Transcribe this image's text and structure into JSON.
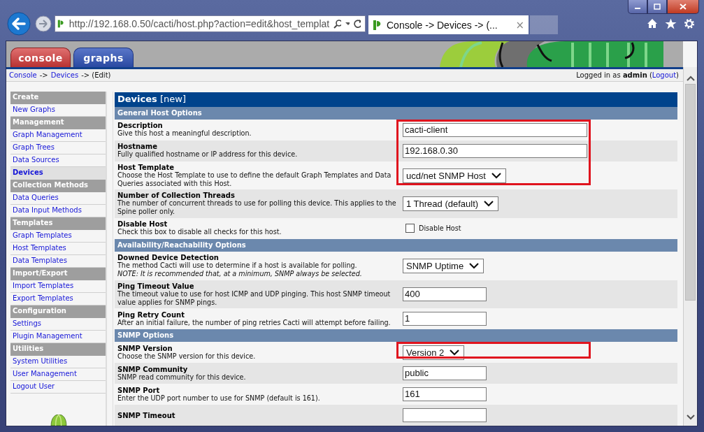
{
  "browser": {
    "url": "http://192.168.0.50/cacti/host.php?action=edit&host_templat",
    "tab_title": "Console -> Devices -> (...",
    "tab_close": "×"
  },
  "app_tabs": [
    {
      "label": "console",
      "selected": true
    },
    {
      "label": "graphs",
      "selected": false
    }
  ],
  "breadcrumb": [
    {
      "kind": "link",
      "text": "Console"
    },
    {
      "kind": "text",
      "text": "->"
    },
    {
      "kind": "link",
      "text": "Devices"
    },
    {
      "kind": "text",
      "text": "-> (Edit)"
    }
  ],
  "login": [
    {
      "kind": "text",
      "text": "Logged in as **admin** ("
    },
    {
      "kind": "link",
      "text": "Logout"
    },
    {
      "kind": "text",
      "text": ")"
    }
  ],
  "sidebar": [
    {
      "kind": "header",
      "label": "Create"
    },
    {
      "kind": "link",
      "label": "New Graphs",
      "selected": false
    },
    {
      "kind": "header",
      "label": "Management"
    },
    {
      "kind": "link",
      "label": "Graph Management",
      "selected": false
    },
    {
      "kind": "link",
      "label": "Graph Trees",
      "selected": false
    },
    {
      "kind": "link",
      "label": "Data Sources",
      "selected": false
    },
    {
      "kind": "link",
      "label": "Devices",
      "selected": true
    },
    {
      "kind": "header",
      "label": "Collection Methods"
    },
    {
      "kind": "link",
      "label": "Data Queries",
      "selected": false
    },
    {
      "kind": "link",
      "label": "Data Input Methods",
      "selected": false
    },
    {
      "kind": "header",
      "label": "Templates"
    },
    {
      "kind": "link",
      "label": "Graph Templates",
      "selected": false
    },
    {
      "kind": "link",
      "label": "Host Templates",
      "selected": false
    },
    {
      "kind": "link",
      "label": "Data Templates",
      "selected": false
    },
    {
      "kind": "header",
      "label": "Import/Export"
    },
    {
      "kind": "link",
      "label": "Import Templates",
      "selected": false
    },
    {
      "kind": "link",
      "label": "Export Templates",
      "selected": false
    },
    {
      "kind": "header",
      "label": "Configuration"
    },
    {
      "kind": "link",
      "label": "Settings",
      "selected": false
    },
    {
      "kind": "link",
      "label": "Plugin Management",
      "selected": false
    },
    {
      "kind": "header",
      "label": "Utilities"
    },
    {
      "kind": "link",
      "label": "System Utilities",
      "selected": false
    },
    {
      "kind": "link",
      "label": "User Management",
      "selected": false
    },
    {
      "kind": "link",
      "label": "Logout User",
      "selected": false
    }
  ],
  "form": {
    "title": "**Devices** [new]",
    "sections": [
      {
        "title": "General Host Options",
        "rows": [
          {
            "label": "Description",
            "description": "Give this host a meaningful description.",
            "kind": "text",
            "value": "cacti-client",
            "wide": true,
            "highlighted": true
          },
          {
            "label": "Hostname",
            "description": "Fully qualified hostname or IP address for this device.",
            "kind": "text",
            "value": "192.168.0.30",
            "wide": true,
            "highlighted": true
          },
          {
            "label": "Host Template",
            "description": "Choose the Host Template to use to define the default Graph Templates and Data Queries associated with this Host.",
            "kind": "select",
            "value": "ucd/net SNMP Host",
            "highlighted": true
          },
          {
            "label": "Number of Collection Threads",
            "description": "The number of concurrent threads to use for polling this device. This applies to the Spine poller only.",
            "kind": "select",
            "value": "1 Thread (default)",
            "highlighted": false
          },
          {
            "label": "Disable Host",
            "description": "Check this box to disable all checks for this host.",
            "kind": "checkbox",
            "checked": false,
            "value": "Disable Host",
            "highlighted": false
          }
        ]
      },
      {
        "title": "Availability/Reachability Options",
        "rows": [
          {
            "label": "Downed Device Detection",
            "description": "The method Cacti will use to determine if a host is available for polling.",
            "note": "NOTE: It is recommended that, at a minimum, SNMP always be selected.",
            "kind": "select",
            "value": "SNMP Uptime",
            "highlighted": false
          },
          {
            "label": "Ping Timeout Value",
            "description": "The timeout value to use for host ICMP and UDP pinging. This host SNMP timeout value applies for SNMP pings.",
            "kind": "text",
            "value": "400",
            "wide": false,
            "highlighted": false
          },
          {
            "label": "Ping Retry Count",
            "description": "After an initial failure, the number of ping retries Cacti will attempt before failing.",
            "kind": "text",
            "value": "1",
            "wide": false,
            "highlighted": false
          }
        ]
      },
      {
        "title": "SNMP Options",
        "rows": [
          {
            "label": "SNMP Version",
            "description": "Choose the SNMP version for this device.",
            "kind": "select",
            "value": "Version 2",
            "highlighted": true
          },
          {
            "label": "SNMP Community",
            "description": "SNMP read community for this device.",
            "kind": "text",
            "value": "public",
            "wide": false,
            "highlighted": false
          },
          {
            "label": "SNMP Port",
            "description": "Enter the UDP port number to use for SNMP (default is 161).",
            "kind": "text",
            "value": "161",
            "wide": false,
            "highlighted": false
          },
          {
            "label": "SNMP Timeout",
            "kind": "text",
            "value": "",
            "wide": false,
            "highlighted": false
          }
        ]
      }
    ]
  }
}
